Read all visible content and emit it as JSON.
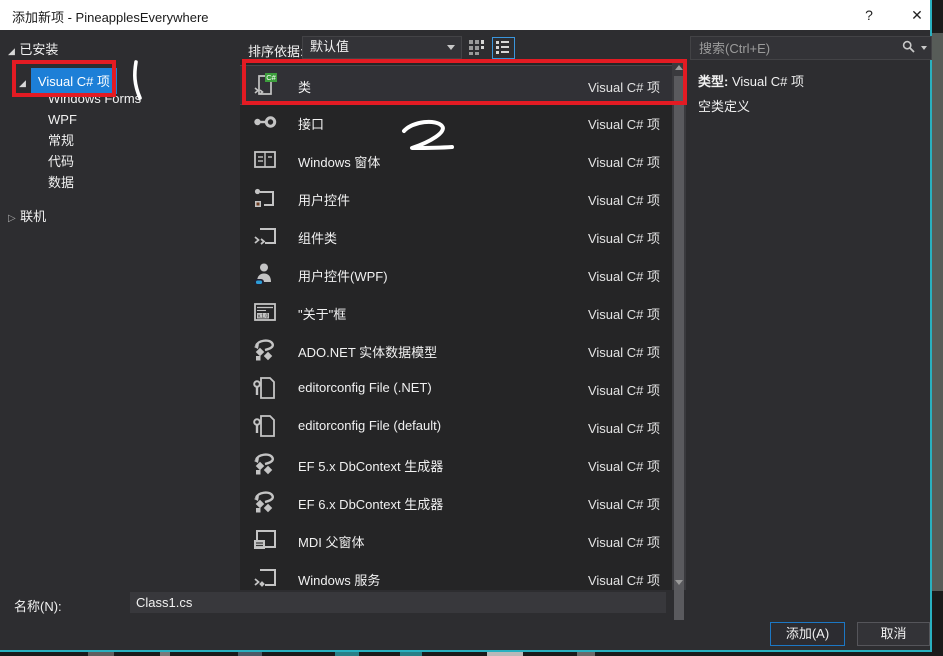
{
  "window": {
    "title": "添加新项 - PineapplesEverywhere",
    "help": "?",
    "close": "✕"
  },
  "sidebar": {
    "installed_label": "已安装",
    "selected_node": "Visual C# 项",
    "children": [
      "Windows Forms",
      "WPF",
      "常规",
      "代码",
      "数据"
    ],
    "online_label": "联机"
  },
  "toolbar": {
    "sort_label": "排序依据:",
    "sort_value": "默认值",
    "view_modes": [
      "small-icons-view",
      "list-view"
    ],
    "active_view": "list-view"
  },
  "templates": {
    "items": [
      {
        "name": "类",
        "icon": "csharp-class-icon",
        "type": "Visual C# 项",
        "selected": true
      },
      {
        "name": "接口",
        "icon": "interface-icon",
        "type": "Visual C# 项",
        "selected": false
      },
      {
        "name": "Windows 窗体",
        "icon": "windows-form-icon",
        "type": "Visual C# 项",
        "selected": false
      },
      {
        "name": "用户控件",
        "icon": "user-control-icon",
        "type": "Visual C# 项",
        "selected": false
      },
      {
        "name": "组件类",
        "icon": "component-class-icon",
        "type": "Visual C# 项",
        "selected": false
      },
      {
        "name": "用户控件(WPF)",
        "icon": "wpf-user-control-icon",
        "type": "Visual C# 项",
        "selected": false
      },
      {
        "name": "\"关于\"框",
        "icon": "about-box-icon",
        "type": "Visual C# 项",
        "selected": false
      },
      {
        "name": "ADO.NET 实体数据模型",
        "icon": "entity-data-model-icon",
        "type": "Visual C# 项",
        "selected": false
      },
      {
        "name": "editorconfig File (.NET)",
        "icon": "editorconfig-icon",
        "type": "Visual C# 项",
        "selected": false
      },
      {
        "name": "editorconfig File (default)",
        "icon": "editorconfig-icon",
        "type": "Visual C# 项",
        "selected": false
      },
      {
        "name": "EF 5.x DbContext 生成器",
        "icon": "entity-data-model-icon",
        "type": "Visual C# 项",
        "selected": false
      },
      {
        "name": "EF 6.x DbContext 生成器",
        "icon": "entity-data-model-icon",
        "type": "Visual C# 项",
        "selected": false
      },
      {
        "name": "MDI 父窗体",
        "icon": "mdi-form-icon",
        "type": "Visual C# 项",
        "selected": false
      },
      {
        "name": "Windows 服务",
        "icon": "windows-service-icon",
        "type": "Visual C# 项",
        "selected": false
      }
    ]
  },
  "search": {
    "placeholder": "搜索(Ctrl+E)"
  },
  "details": {
    "type_label": "类型:",
    "type_value": "Visual C# 项",
    "description": "空类定义"
  },
  "footer": {
    "name_label": "名称(N):",
    "name_value": "Class1.cs",
    "add_label": "添加(A)",
    "cancel_label": "取消"
  },
  "annotations": {
    "step_number": "2"
  },
  "colors": {
    "annotation_red": "#e31b23",
    "accent_teal": "#29b1c0",
    "tree_selection_blue": "#1d7fd7",
    "default_button_blue": "#1c77c4",
    "dialog_bg": "#2d2d30",
    "list_bg": "#252526",
    "titlebar_bg": "#ffffff"
  }
}
